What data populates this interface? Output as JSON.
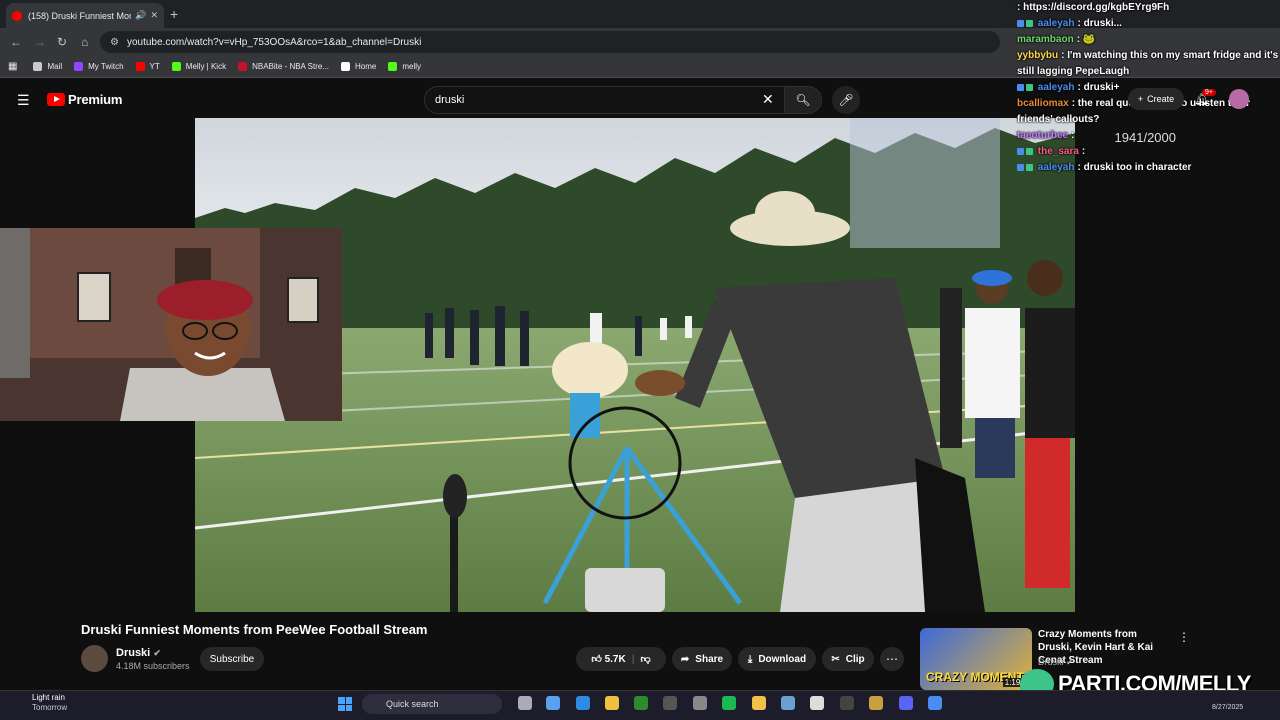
{
  "browser": {
    "tab_title": "(158) Druski Funniest Mom",
    "url": "youtube.com/watch?v=vHp_753OOsA&rco=1&ab_channel=Druski",
    "bookmarks": [
      "Mail",
      "My Twitch",
      "YT",
      "Melly | Kick",
      "NBABite - NBA Stre...",
      "Home",
      "melly"
    ]
  },
  "youtube": {
    "brand": "Premium",
    "search_value": "druski",
    "create_label": "Create",
    "notif_count": "9+",
    "video_counter": "1941/2000",
    "video_title": "Druski Funniest Moments from PeeWee Football Stream",
    "channel_name": "Druski",
    "subscribers": "4.18M subscribers",
    "subscribe_label": "Subscribe",
    "likes": "5.7K",
    "share_label": "Share",
    "download_label": "Download",
    "clip_label": "Clip",
    "rec_title": "Crazy Moments from Druski, Kevin Hart & Kai Cenat Stream",
    "rec_channel": "Druski",
    "rec_thumb_text": "CRAZY MOMENTS",
    "rec_duration": "1:19:2"
  },
  "chat": {
    "lines": [
      {
        "user": "",
        "text": ": https://discord.gg/kgbEYrg9Fh",
        "color": "#ffffff"
      },
      {
        "user": "aaleyah",
        "text": ": druski...",
        "color": "#4a8df0"
      },
      {
        "user": "marambaon",
        "text": ":",
        "color": "#6bd96b"
      },
      {
        "user": "yybbybu",
        "text": ": I'm watching this on my smart fridge and it's still lagging PepeLaugh",
        "color": "#ffd54a"
      },
      {
        "user": "aaleyah",
        "text": ": druski+",
        "color": "#4a8df0"
      },
      {
        "user": "bcalliomax",
        "text": ": the real question is: do u listen to ur friends' callouts?",
        "color": "#e78a3a"
      },
      {
        "user": "taeoturbee",
        "text": ":",
        "color": "#c77dff"
      },
      {
        "user": "the_sara",
        "text": ":",
        "color": "#ff5b7f"
      },
      {
        "user": "aaleyah",
        "text": ": druski too in character",
        "color": "#4a8df0"
      }
    ]
  },
  "overlay": {
    "brand": "PARTI.COM/MELLY"
  },
  "taskbar": {
    "weather": "Light rain",
    "weather_sub": "Tomorrow",
    "search_placeholder": "Quick search",
    "date": "8/27/2025"
  }
}
